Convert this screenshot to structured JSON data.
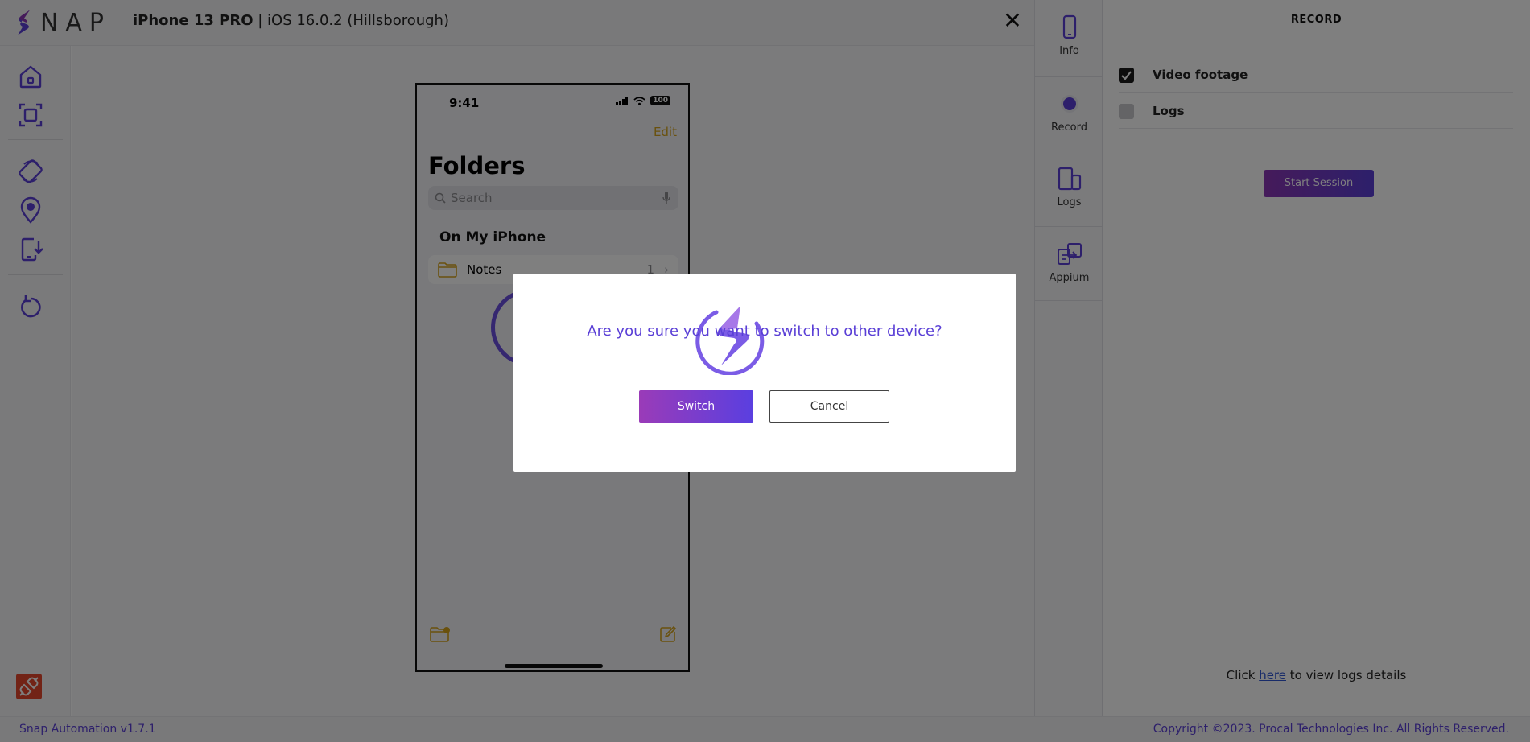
{
  "app": {
    "logo_text": "NAP",
    "device_model": "iPhone 13 PRO",
    "device_os": "| iOS 16.0.2 (Hillsborough)",
    "close_symbol": "✕"
  },
  "phone": {
    "time": "9:41",
    "battery": "100",
    "edit": "Edit",
    "heading": "Folders",
    "search_placeholder": "Search",
    "section": "On My iPhone",
    "row_name": "Notes",
    "row_count": "1",
    "row_chevron": "›"
  },
  "tools": [
    {
      "label": "Info",
      "icon": "phone-icon"
    },
    {
      "label": "Record",
      "icon": "record-icon"
    },
    {
      "label": "Logs",
      "icon": "devices-icon"
    },
    {
      "label": "Appium",
      "icon": "appium-icon"
    }
  ],
  "record": {
    "title": "RECORD",
    "options": [
      {
        "label": "Video footage",
        "checked": true
      },
      {
        "label": "Logs",
        "checked": false
      }
    ],
    "start_button": "Start Session",
    "logs_prefix": "Click ",
    "logs_link": "here",
    "logs_suffix": " to view logs details"
  },
  "footer": {
    "version": "Snap Automation v1.7.1",
    "copyright": "Copyright ©2023. Procal Technologies Inc. All Rights Reserved."
  },
  "modal": {
    "question": "Are you sure you want to switch to other device?",
    "switch_label": "Switch",
    "cancel_label": "Cancel"
  },
  "colors": {
    "accent": "#5a3fd6",
    "accent_gradient_start": "#9a3bb8",
    "phone_accent": "#d4a21a",
    "disconnect": "#e4462d"
  }
}
